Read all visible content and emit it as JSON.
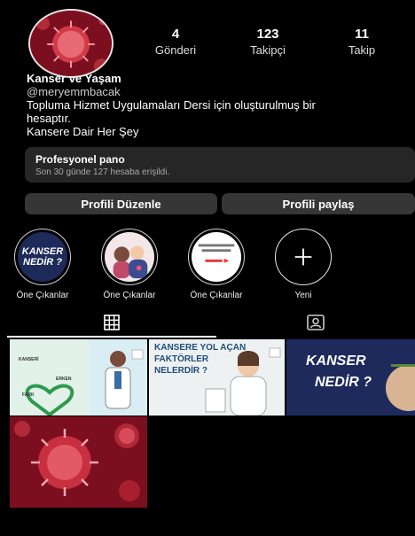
{
  "profile": {
    "stats": [
      {
        "value": "4",
        "label": "Gönderi"
      },
      {
        "value": "123",
        "label": "Takipçi"
      },
      {
        "value": "11",
        "label": "Takip"
      }
    ],
    "display_name": "Kanser ve Yaşam",
    "username": "@meryemmbacak",
    "bio_line1": "Topluma Hizmet Uygulamaları Dersi için oluşturulmuş bir",
    "bio_line2": "hesaptır.",
    "bio_line3": "Kansere Dair Her Şey"
  },
  "dashboard": {
    "title": "Profesyonel pano",
    "subtitle": "Son 30 günde 127 hesaba erişildi."
  },
  "buttons": {
    "edit_profile": "Profili Düzenle",
    "share_profile": "Profili paylaş"
  },
  "highlights": [
    {
      "label": "Öne Çıkanlar",
      "cover_line1": "KANSER",
      "cover_line2": "NEDİR ?"
    },
    {
      "label": "Öne Çıkanlar"
    },
    {
      "label": "Öne Çıkanlar"
    },
    {
      "label": "Yeni"
    }
  ],
  "tabs": [
    {
      "icon": "grid-icon"
    },
    {
      "icon": "tagged-icon"
    }
  ],
  "posts": [
    {
      "labels": [
        "KANSERİ",
        "ERKEN",
        "FARK"
      ]
    },
    {
      "title_line1": "KANSERE YOL AÇAN",
      "title_line2": "FAKTÖRLER",
      "title_line3": "NELERDİR ?"
    },
    {
      "title_line1": "KANSER",
      "title_line2": "NEDİR ?"
    },
    {}
  ],
  "colors": {
    "background": "#000000",
    "surface": "#262626",
    "button": "#363636",
    "brand_red": "#8b1022"
  }
}
